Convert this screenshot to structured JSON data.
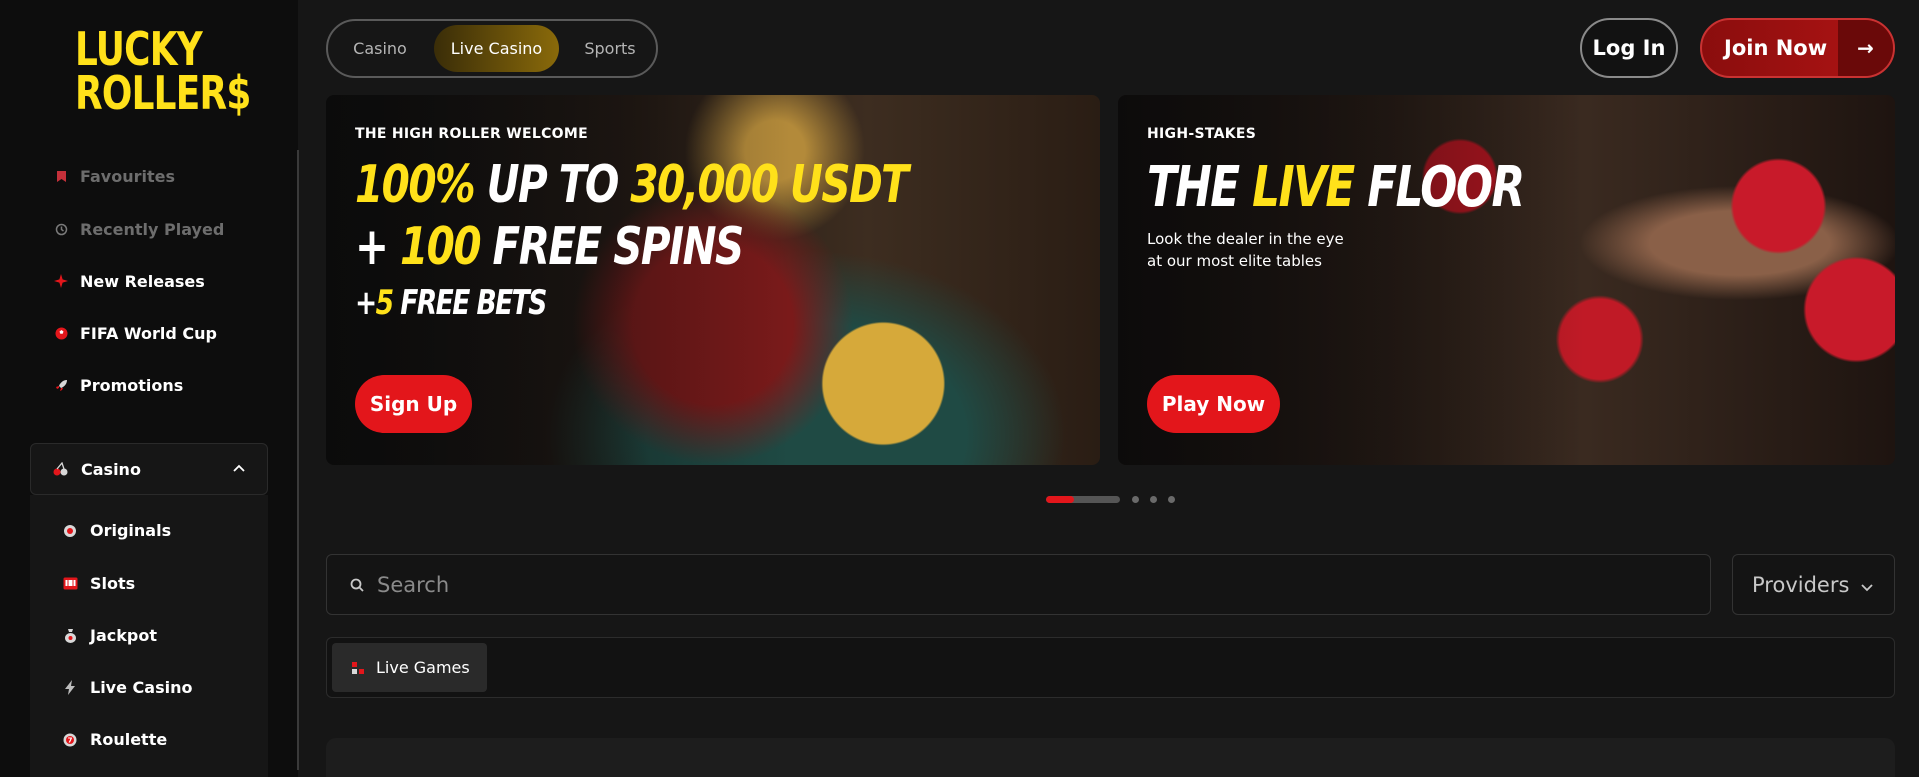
{
  "brand": {
    "logo_line1": "LUCKY",
    "logo_line2": "ROLLER$"
  },
  "sidebar": {
    "items": [
      {
        "label": "Favourites",
        "icon": "bookmark-icon"
      },
      {
        "label": "Recently Played",
        "icon": "history-icon"
      },
      {
        "label": "New Releases",
        "icon": "sparkle-icon"
      },
      {
        "label": "FIFA World Cup",
        "icon": "soccer-ball-icon"
      },
      {
        "label": "Promotions",
        "icon": "rocket-icon"
      }
    ],
    "casino_section": {
      "label": "Casino",
      "expanded": true,
      "items": [
        {
          "label": "Originals",
          "icon": "originals-icon"
        },
        {
          "label": "Slots",
          "icon": "slot-machine-icon"
        },
        {
          "label": "Jackpot",
          "icon": "money-bag-icon"
        },
        {
          "label": "Live Casino",
          "icon": "lightning-icon"
        },
        {
          "label": "Roulette",
          "icon": "roulette-icon"
        }
      ]
    }
  },
  "header": {
    "tabs": [
      {
        "label": "Casino",
        "active": false
      },
      {
        "label": "Live Casino",
        "active": true
      },
      {
        "label": "Sports",
        "active": false
      }
    ],
    "login_label": "Log In",
    "join_label": "Join Now",
    "join_arrow": "→"
  },
  "banners": [
    {
      "eyebrow": "THE HIGH ROLLER WELCOME",
      "line1_a": "100%",
      "line1_b": " UP TO ",
      "line1_c": "30,000 USDT",
      "line2_a": "+ ",
      "line2_b": "100",
      "line2_c": " FREE SPINS",
      "line3_a": "+",
      "line3_b": "5",
      "line3_c": " FREE BETS",
      "cta": "Sign Up"
    },
    {
      "eyebrow": "HIGH-STAKES",
      "headline_a": "THE ",
      "headline_b": "LIVE",
      "headline_c": " FLOOR",
      "sub_line1": "Look the dealer in the eye",
      "sub_line2": "at our most elite tables",
      "cta": "Play Now"
    }
  ],
  "carousel": {
    "total_dots": 4,
    "active_index": 0,
    "progress": 0.38
  },
  "search": {
    "placeholder": "Search",
    "value": ""
  },
  "providers": {
    "label": "Providers"
  },
  "categories": [
    {
      "label": "Live Games",
      "icon": "live-games-icon"
    }
  ],
  "colors": {
    "accent_yellow": "#ffe11a",
    "accent_red": "#e3161b",
    "join_red": "#b01414",
    "active_tab_gold": "#8a6a0a"
  }
}
